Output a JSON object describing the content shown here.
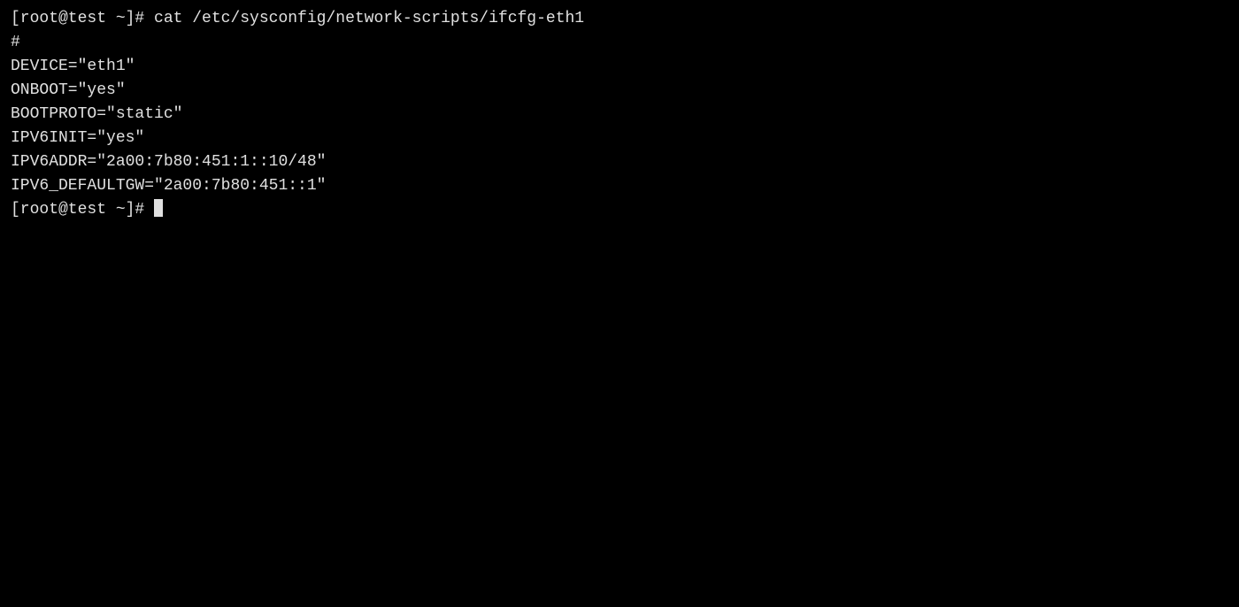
{
  "terminal": {
    "prompt1": "[root@test ~]# ",
    "command1": "cat /etc/sysconfig/network-scripts/ifcfg-eth1",
    "output": [
      "#",
      "DEVICE=\"eth1\"",
      "ONBOOT=\"yes\"",
      "BOOTPROTO=\"static\"",
      "IPV6INIT=\"yes\"",
      "IPV6ADDR=\"2a00:7b80:451:1::10/48\"",
      "IPV6_DEFAULTGW=\"2a00:7b80:451::1\""
    ],
    "prompt2": "[root@test ~]# "
  }
}
